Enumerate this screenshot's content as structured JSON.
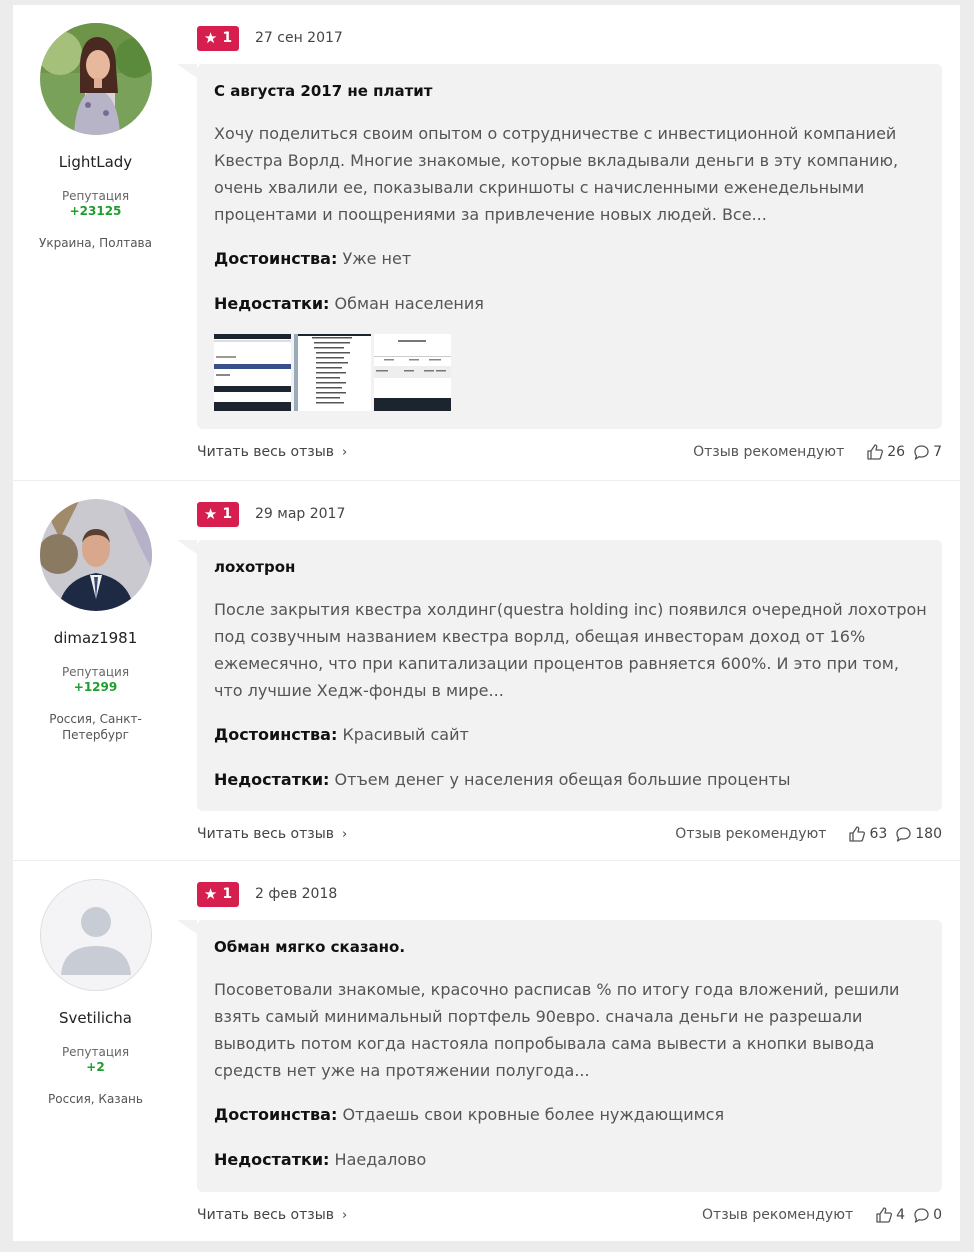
{
  "reviews": [
    {
      "author": {
        "name": "LightLady",
        "reputation_label": "Репутация",
        "reputation": "+23125",
        "location": "Украина, Полтава"
      },
      "rating": "1",
      "date": "27 сен 2017",
      "title": "С августа 2017 не платит",
      "text": "Хочу поделиться своим опытом о сотрудничестве с инвестиционной компанией Квестра Ворлд. Многие знакомые, которые вкладывали деньги в эту компанию, очень хвалили ее, показывали скриншоты с начисленными еженедельными процентами и поощрениями за привлечение новых людей. Все...",
      "pros_label": "Достоинства:",
      "pros": "Уже нет",
      "cons_label": "Недостатки:",
      "cons": "Обман населения",
      "read_more": "Читать весь отзыв",
      "recommend_label": "Отзыв рекомендуют",
      "likes": "26",
      "comments": "7"
    },
    {
      "author": {
        "name": "dimaz1981",
        "reputation_label": "Репутация",
        "reputation": "+1299",
        "location": "Россия, Санкт-Петербург"
      },
      "rating": "1",
      "date": "29 мар 2017",
      "title": "лохотрон",
      "text": "После закрытия квестра холдинг(questra holding inc) появился очередной лохотрон под созвучным названием квестра ворлд, обещая инвесторам доход от 16% ежемесячно, что при капитализации процентов равняется 600%. И это при том, что лучшие Хедж-фонды в мире...",
      "pros_label": "Достоинства:",
      "pros": "Красивый сайт",
      "cons_label": "Недостатки:",
      "cons": "Отъем денег у населения обещая большие проценты",
      "read_more": "Читать весь отзыв",
      "recommend_label": "Отзыв рекомендуют",
      "likes": "63",
      "comments": "180"
    },
    {
      "author": {
        "name": "Svetilicha",
        "reputation_label": "Репутация",
        "reputation": "+2",
        "location": "Россия, Казань"
      },
      "rating": "1",
      "date": "2 фев 2018",
      "title": "Обман мягко сказано.",
      "text": "Посоветовали знакомые, красочно расписав % по итогу года вложений, решили взять самый минимальный портфель 90евро. сначала деньги не разрешали выводить потом когда настояла попробывала сама вывести а кнопки вывода средств нет уже на протяжении полугода...",
      "pros_label": "Достоинства:",
      "pros": "Отдаешь свои кровные более нуждающимся",
      "cons_label": "Недостатки:",
      "cons": "Наедалово",
      "read_more": "Читать весь отзыв",
      "recommend_label": "Отзыв рекомендуют",
      "likes": "4",
      "comments": "0"
    }
  ],
  "colors": {
    "rating_badge": "#d61f4e",
    "reputation": "#1f9d2e",
    "bubble": "#f2f2f2"
  },
  "icons": {
    "rating": "star-icon",
    "likes": "thumbs-up-icon",
    "comments": "comment-icon",
    "read_more": "chevron-right-icon"
  }
}
